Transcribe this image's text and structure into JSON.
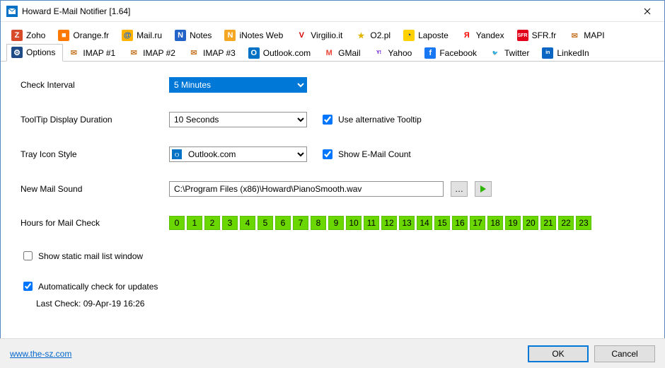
{
  "window": {
    "title": "Howard E-Mail Notifier [1.64]"
  },
  "tabs_row1": [
    {
      "label": "Zoho",
      "icon_bg": "#d74b2a",
      "icon_fg": "#fff",
      "glyph": "Z"
    },
    {
      "label": "Orange.fr",
      "icon_bg": "#ff7900",
      "icon_fg": "#fff",
      "glyph": "■"
    },
    {
      "label": "Mail.ru",
      "icon_bg": "#ffb300",
      "icon_fg": "#005ff9",
      "glyph": "@"
    },
    {
      "label": "Notes",
      "icon_bg": "#2463c7",
      "icon_fg": "#fff",
      "glyph": "N"
    },
    {
      "label": "iNotes Web",
      "icon_bg": "#f5a623",
      "icon_fg": "#fff",
      "glyph": "N"
    },
    {
      "label": "Virgilio.it",
      "icon_bg": "#fff",
      "icon_fg": "#d40000",
      "glyph": "V"
    },
    {
      "label": "O2.pl",
      "icon_bg": "#fff",
      "icon_fg": "#e2b500",
      "glyph": "★"
    },
    {
      "label": "Laposte",
      "icon_bg": "#ffd100",
      "icon_fg": "#0030a0",
      "glyph": "◔"
    },
    {
      "label": "Yandex",
      "icon_bg": "#fff",
      "icon_fg": "#ff0000",
      "glyph": "Я"
    },
    {
      "label": "SFR.fr",
      "icon_bg": "#e2001a",
      "icon_fg": "#fff",
      "glyph": "SFR"
    },
    {
      "label": "MAPI",
      "icon_bg": "#fff",
      "icon_fg": "#c97c2f",
      "glyph": "✉"
    }
  ],
  "tabs_row2": [
    {
      "label": "Options",
      "icon_bg": "#1e4a86",
      "icon_fg": "#fff",
      "glyph": "⚙",
      "selected": true
    },
    {
      "label": "IMAP #1",
      "icon_bg": "#fff",
      "icon_fg": "#c97c2f",
      "glyph": "✉"
    },
    {
      "label": "IMAP #2",
      "icon_bg": "#fff",
      "icon_fg": "#c97c2f",
      "glyph": "✉"
    },
    {
      "label": "IMAP #3",
      "icon_bg": "#fff",
      "icon_fg": "#c97c2f",
      "glyph": "✉"
    },
    {
      "label": "Outlook.com",
      "icon_bg": "#0072c6",
      "icon_fg": "#fff",
      "glyph": "O"
    },
    {
      "label": "GMail",
      "icon_bg": "#fff",
      "icon_fg": "#ea4335",
      "glyph": "M"
    },
    {
      "label": "Yahoo",
      "icon_bg": "#fff",
      "icon_fg": "#5f01d1",
      "glyph": "Y!"
    },
    {
      "label": "Facebook",
      "icon_bg": "#1877f2",
      "icon_fg": "#fff",
      "glyph": "f"
    },
    {
      "label": "Twitter",
      "icon_bg": "#fff",
      "icon_fg": "#1da1f2",
      "glyph": "🐦"
    },
    {
      "label": "LinkedIn",
      "icon_bg": "#0a66c2",
      "icon_fg": "#fff",
      "glyph": "in"
    }
  ],
  "options": {
    "check_interval": {
      "label": "Check Interval",
      "value": "5 Minutes"
    },
    "tooltip_duration": {
      "label": "ToolTip Display Duration",
      "value": "10 Seconds"
    },
    "use_alt_tooltip": {
      "label": "Use alternative Tooltip",
      "checked": true
    },
    "tray_icon_style": {
      "label": "Tray Icon Style",
      "value": "Outlook.com"
    },
    "show_email_count": {
      "label": "Show E-Mail Count",
      "checked": true
    },
    "new_mail_sound": {
      "label": "New Mail Sound",
      "value": "C:\\Program Files (x86)\\Howard\\PianoSmooth.wav"
    },
    "hours_label": "Hours for Mail Check",
    "hours": [
      "0",
      "1",
      "2",
      "3",
      "4",
      "5",
      "6",
      "7",
      "8",
      "9",
      "10",
      "11",
      "12",
      "13",
      "14",
      "15",
      "16",
      "17",
      "18",
      "19",
      "20",
      "21",
      "22",
      "23"
    ],
    "show_static_list": {
      "label": "Show static mail list window",
      "checked": false
    },
    "auto_update": {
      "label": "Automatically check for updates",
      "checked": true
    },
    "last_check": "Last Check: 09-Apr-19 16:26"
  },
  "footer": {
    "link": "www.the-sz.com",
    "ok": "OK",
    "cancel": "Cancel"
  }
}
